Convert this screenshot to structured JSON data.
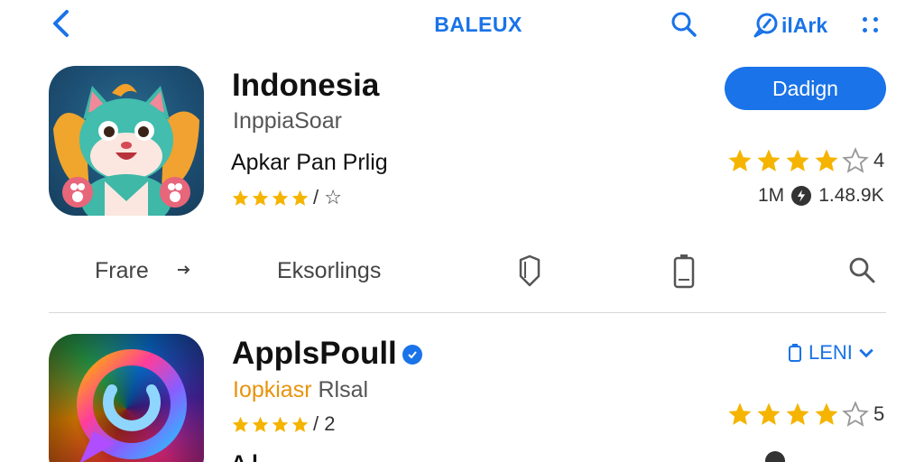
{
  "header": {
    "title": "BALEUX",
    "link_label": "ilArk",
    "back_icon": "chevron-left-icon",
    "search_icon": "search-icon",
    "more_icon": "grid-dots-icon"
  },
  "apps": [
    {
      "name": "Indonesia",
      "subtitle": "InppiaSoar",
      "description": "Apkar Pan Prlig",
      "small_rating_tail": "/ ☆",
      "big_rating_tail": "4",
      "get_label": "Dadign",
      "meta_left": "1M",
      "meta_right": "1.48.9K",
      "icon": "cat-mascot-icon"
    },
    {
      "name": "ApplsPoull",
      "subtitle_accent": "Iopkiasr",
      "subtitle_rest": "Rlsal",
      "small_rating_tail": "/ 2",
      "big_rating_tail": "5",
      "open_label": "LENI",
      "partial_text": "A     l",
      "icon": "chat-bubble-icon"
    }
  ],
  "tabs": {
    "first_label": "Frare",
    "second_label": "Eksorlings",
    "icons": [
      "shield-icon",
      "battery-icon",
      "search-icon"
    ]
  },
  "colors": {
    "accent": "#1a73e8",
    "star": "#f5b400",
    "subtitle_orange": "#e8930c"
  }
}
